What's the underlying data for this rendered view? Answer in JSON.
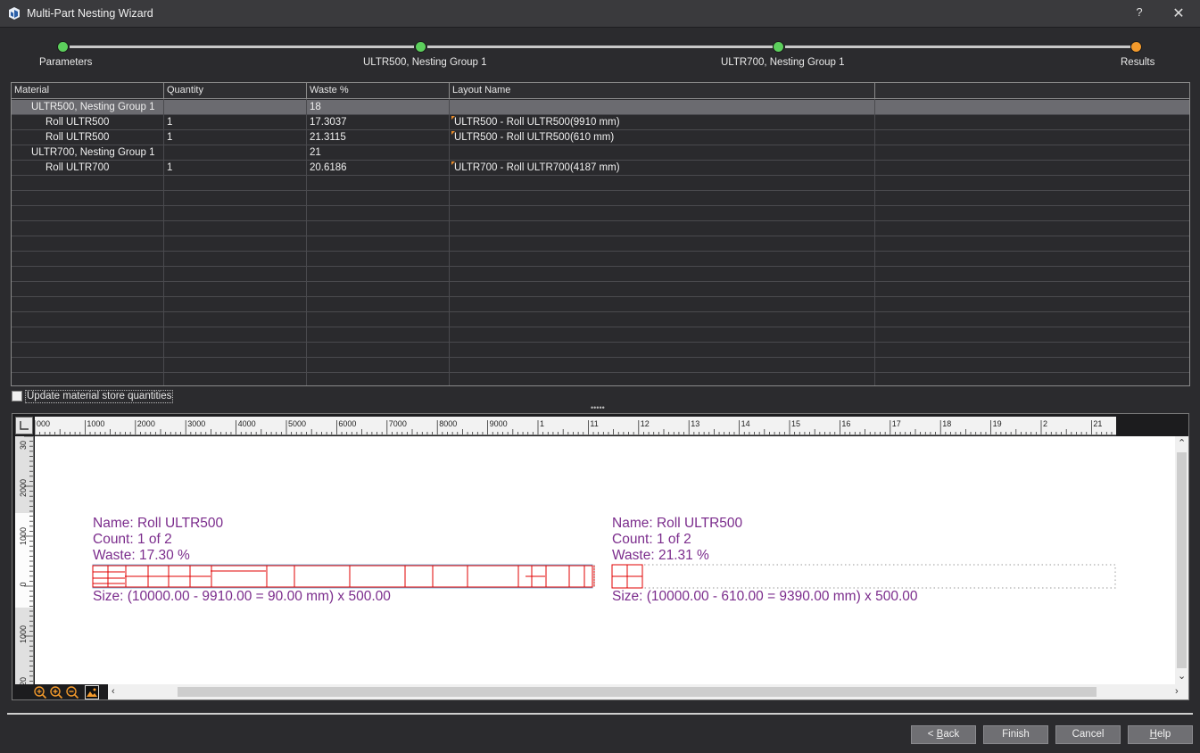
{
  "window": {
    "title": "Multi-Part Nesting Wizard",
    "help": "?",
    "close": "✕"
  },
  "colors": {
    "step_done": "#5ccf5c",
    "step_current": "#f39a2c",
    "nest_outline": "#e00000",
    "nest_text": "#7b2c8c"
  },
  "steps": [
    {
      "label": "Parameters",
      "state": "done"
    },
    {
      "label": "ULTR500, Nesting Group 1",
      "state": "done"
    },
    {
      "label": "ULTR700, Nesting Group 1",
      "state": "done"
    },
    {
      "label": "Results",
      "state": "current"
    }
  ],
  "grid": {
    "columns": [
      "Material",
      "Quantity",
      "Waste %",
      "Layout Name"
    ],
    "rows": [
      {
        "material": "ULTR500, Nesting Group 1",
        "quantity": "",
        "waste": "18",
        "layout": "",
        "level": 1,
        "selected": true,
        "flag": false
      },
      {
        "material": "Roll ULTR500",
        "quantity": "1",
        "waste": "17.3037",
        "layout": "ULTR500 - Roll ULTR500(9910 mm)",
        "level": 2,
        "selected": false,
        "flag": true
      },
      {
        "material": "Roll ULTR500",
        "quantity": "1",
        "waste": "21.3115",
        "layout": "ULTR500 - Roll ULTR500(610 mm)",
        "level": 2,
        "selected": false,
        "flag": true
      },
      {
        "material": "ULTR700, Nesting Group 1",
        "quantity": "",
        "waste": "21",
        "layout": "",
        "level": 1,
        "selected": false,
        "flag": false
      },
      {
        "material": "Roll ULTR700",
        "quantity": "1",
        "waste": "20.6186",
        "layout": "ULTR700 - Roll ULTR700(4187 mm)",
        "level": 2,
        "selected": false,
        "flag": true
      }
    ]
  },
  "update_store_label": "Update material store quantities",
  "update_store_checked": false,
  "ruler": {
    "h_labels": [
      "000",
      "1000",
      "2000",
      "3000",
      "4000",
      "5000",
      "6000",
      "7000",
      "8000",
      "9000",
      "1",
      "11",
      "12",
      "13",
      "14",
      "15",
      "16",
      "17",
      "18",
      "19",
      "2",
      "21"
    ],
    "v_labels": [
      "30",
      "2000",
      "1000",
      "0",
      "1000",
      "20"
    ]
  },
  "layouts": [
    {
      "name_line": "Name:  Roll ULTR500",
      "count_line": "Count:  1 of 2",
      "waste_line": "Waste:  17.30 %",
      "size_line": "Size:  (10000.00 - 9910.00 = 90.00 mm) x 500.00"
    },
    {
      "name_line": "Name:  Roll ULTR500",
      "count_line": "Count:  1 of 2",
      "waste_line": "Waste:  21.31 %",
      "size_line": "Size:  (10000.00 - 610.00 = 9390.00 mm) x 500.00"
    }
  ],
  "buttons": {
    "back": "< Back",
    "finish": "Finish",
    "cancel": "Cancel",
    "help": "Help"
  }
}
